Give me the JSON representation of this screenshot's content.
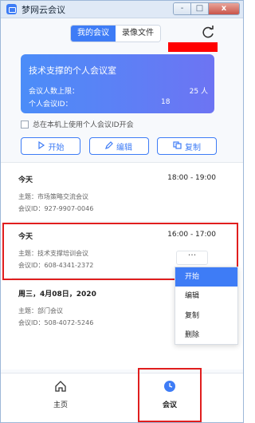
{
  "window": {
    "title": "梦网云会议",
    "controls": [
      "-",
      "□",
      "x"
    ]
  },
  "tabs": [
    {
      "label": "我的会议",
      "active": true
    },
    {
      "label": "录像文件",
      "active": false
    }
  ],
  "refresh_icon": "refresh-icon",
  "room": {
    "title": "技术支撑的个人会议室",
    "capacity_label": "会议人数上限：",
    "capacity_value": "25 人",
    "id_label": "个人会议ID：",
    "id_value": "18"
  },
  "checkbox": {
    "label": "总在本机上使用个人会议ID开会",
    "checked": false
  },
  "actions": [
    {
      "label": "开始",
      "icon": "play-icon"
    },
    {
      "label": "编辑",
      "icon": "pencil-icon"
    },
    {
      "label": "复制",
      "icon": "copy-icon"
    }
  ],
  "meetings": [
    {
      "day": "今天",
      "time": "18:00 - 19:00",
      "subject": "主题：市场策略交流会议",
      "meeting_id": "会议ID：927-9907-0046"
    },
    {
      "day": "今天",
      "time": "16:00 - 17:00",
      "subject": "主题：技术支撑培训会议",
      "meeting_id": "会议ID：608-4341-2372"
    },
    {
      "day": "周三，4月08日，2020",
      "time": "",
      "subject": "主题：部门会议",
      "meeting_id": "会议ID：508-4072-5246"
    }
  ],
  "more_button": "···",
  "context_menu": [
    "开始",
    "编辑",
    "复制",
    "删除"
  ],
  "navbar": [
    {
      "label": "主页",
      "icon": "home-icon"
    },
    {
      "label": "会议",
      "icon": "clock-icon"
    }
  ],
  "colors": {
    "accent": "#3e7cf6",
    "highlight": "#e01e1e",
    "redaction": "#ff0000"
  }
}
